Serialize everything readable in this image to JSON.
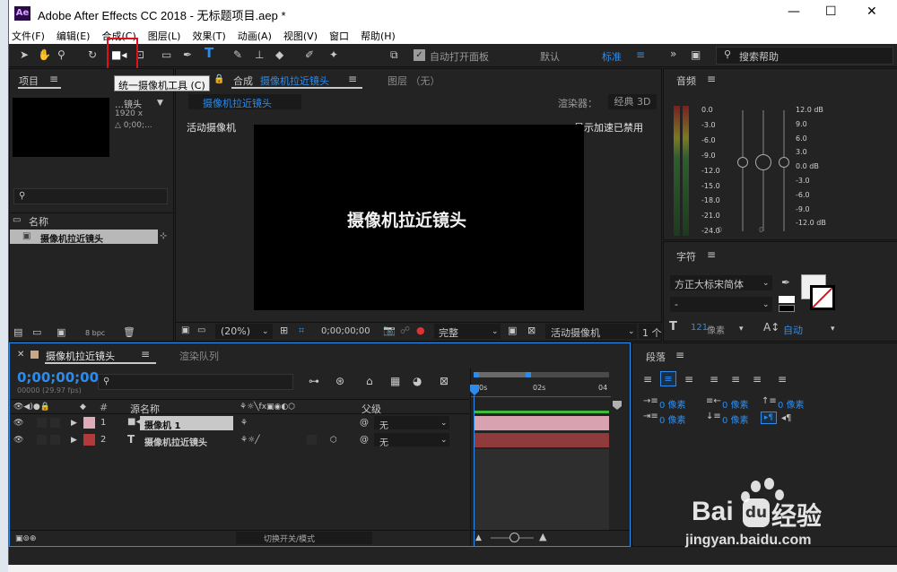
{
  "window": {
    "title": "Adobe After Effects CC 2018 - 无标题项目.aep *",
    "app_icon": "Ae",
    "minimize": "—",
    "maximize": "☐",
    "close": "✕"
  },
  "menu": [
    "文件(F)",
    "编辑(E)",
    "合成(C)",
    "图层(L)",
    "效果(T)",
    "动画(A)",
    "视图(V)",
    "窗口",
    "帮助(H)"
  ],
  "toolbar": {
    "auto_open": "自动打开面板",
    "default": "默认",
    "standard": "标准",
    "search_placeholder": "搜索帮助"
  },
  "tooltip": "统一摄像机工具 (C)",
  "project": {
    "tab": "项目",
    "comp_info_title": "…镜头",
    "size": "1920 x",
    "delta": "△ 0;00;...",
    "col_name": "名称",
    "item": "摄像机拉近镜头",
    "bpc": "8 bpc"
  },
  "comp": {
    "tab_prefix": "合成",
    "tab_name": "摄像机拉近镜头",
    "layer_tab": "图层 （无）",
    "breadcrumb": "摄像机拉近镜头",
    "renderer_label": "渲染器：",
    "renderer": "经典 3D",
    "active_camera": "活动摄像机",
    "accel": "显示加速已禁用",
    "canvas_text": "摄像机拉近镜头",
    "zoom": "(20%)",
    "timecode": "0;00;00;00",
    "quality": "完整",
    "view": "活动摄像机",
    "views": "1 个"
  },
  "audio": {
    "title": "音频",
    "left_scale": [
      "0.0",
      "-3.0",
      "-6.0",
      "-9.0",
      "-12.0",
      "-15.0",
      "-18.0",
      "-21.0",
      "-24.0"
    ],
    "right_scale": [
      "12.0 dB",
      "9.0",
      "6.0",
      "3.0",
      "0.0 dB",
      "-3.0",
      "-6.0",
      "-9.0",
      "-12.0 dB"
    ],
    "zero_a": "0",
    "zero_b": "0"
  },
  "character": {
    "title": "字符",
    "font": "方正大标宋简体",
    "style": "-",
    "size_value": "121",
    "size_unit": "像素",
    "leading": "自动"
  },
  "paragraph": {
    "title": "段落",
    "indent1": "0 像素",
    "indent2": "0 像素",
    "indent3": "0 像素",
    "indent4": "0 像素",
    "indent5": "0 像素"
  },
  "timeline": {
    "tab": "摄像机拉近镜头",
    "render_queue": "渲染队列",
    "timecode": "0;00;00;00",
    "fps": "00000 (29.97 fps)",
    "col_num": "#",
    "col_source": "源名称",
    "col_parent": "父级",
    "switches": "切换开关/模式",
    "ruler": [
      "0s",
      "02s",
      "04"
    ],
    "layers": [
      {
        "num": "1",
        "type": "camera",
        "name": "摄像机 1",
        "parent": "无",
        "color": "#e0aab8",
        "bar": "#d9a2b1"
      },
      {
        "num": "2",
        "type": "T",
        "name": "摄像机拉近镜头",
        "parent": "无",
        "color": "#b23a3a",
        "bar": "#8f3b3b"
      }
    ]
  },
  "watermark": {
    "brand": "Bai",
    "brand2": "经验",
    "url": "jingyan.baidu.com"
  }
}
